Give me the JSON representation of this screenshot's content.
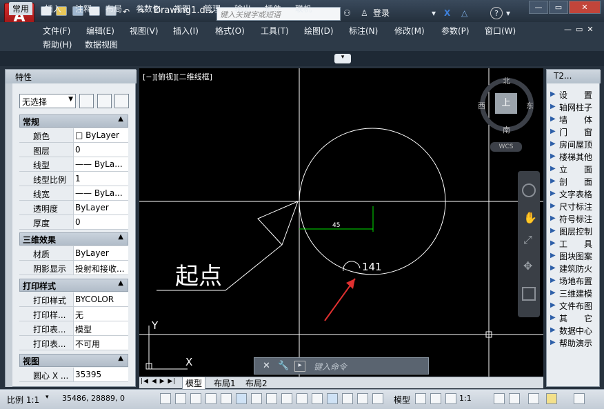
{
  "app": {
    "doc_title": "Drawing1.d...",
    "logo": "A"
  },
  "search": {
    "placeholder": "键入关键字或短语"
  },
  "titlebar": {
    "login": "登录"
  },
  "menu": {
    "row1": [
      "文件(F)",
      "编辑(E)",
      "视图(V)",
      "插入(I)",
      "格式(O)",
      "工具(T)",
      "绘图(D)",
      "标注(N)",
      "修改(M)",
      "参数(P)",
      "窗口(W)"
    ],
    "row2": [
      "帮助(H)",
      "数据视图"
    ]
  },
  "ribbon": {
    "tabs": [
      "常用",
      "插入",
      "注释",
      "布局",
      "参数化",
      "视图",
      "管理",
      "输出",
      "插件",
      "联机"
    ],
    "active": "常用"
  },
  "viewport": {
    "label": "[−][俯视][二维线框]"
  },
  "viewcube": {
    "north": "北",
    "south": "南",
    "east": "东",
    "west": "西",
    "top": "上",
    "wcs": "WCS"
  },
  "drawing": {
    "dimension": "45",
    "angle_text": "141",
    "annotation": "起点",
    "ucs_y": "Y",
    "ucs_x": "X"
  },
  "properties": {
    "title": "特性",
    "selection": "无选择",
    "sections": [
      {
        "name": "常规",
        "rows": [
          [
            "颜色",
            "□ ByLayer"
          ],
          [
            "图层",
            "0"
          ],
          [
            "线型",
            "—— ByLa..."
          ],
          [
            "线型比例",
            "1"
          ],
          [
            "线宽",
            "—— ByLa..."
          ],
          [
            "透明度",
            "ByLayer"
          ],
          [
            "厚度",
            "0"
          ]
        ]
      },
      {
        "name": "三维效果",
        "rows": [
          [
            "材质",
            "ByLayer"
          ],
          [
            "阴影显示",
            "投射和接收..."
          ]
        ]
      },
      {
        "name": "打印样式",
        "rows": [
          [
            "打印样式",
            "BYCOLOR"
          ],
          [
            "打印样...",
            "无"
          ],
          [
            "打印表...",
            "模型"
          ],
          [
            "打印表...",
            "不可用"
          ]
        ]
      },
      {
        "name": "视图",
        "rows": [
          [
            "圆心 X ...",
            "35395"
          ]
        ]
      }
    ]
  },
  "tool_palette": {
    "title": "T2...",
    "items": [
      "设　　置",
      "轴网柱子",
      "墙　　体",
      "门　　窗",
      "房间屋顶",
      "楼梯其他",
      "立　　面",
      "剖　　面",
      "文字表格",
      "尺寸标注",
      "符号标注",
      "图层控制",
      "工　　具",
      "图块图案",
      "建筑防火",
      "场地布置",
      "三维建模",
      "文件布图",
      "其　　它",
      "数据中心",
      "帮助演示"
    ]
  },
  "layout_tabs": [
    "模型",
    "布局1",
    "布局2"
  ],
  "command": {
    "placeholder": "键入命令"
  },
  "status": {
    "scale": "比例 1:1",
    "coords": "35486, 28889, 0",
    "model": "模型",
    "anno_scale": "1:1"
  }
}
